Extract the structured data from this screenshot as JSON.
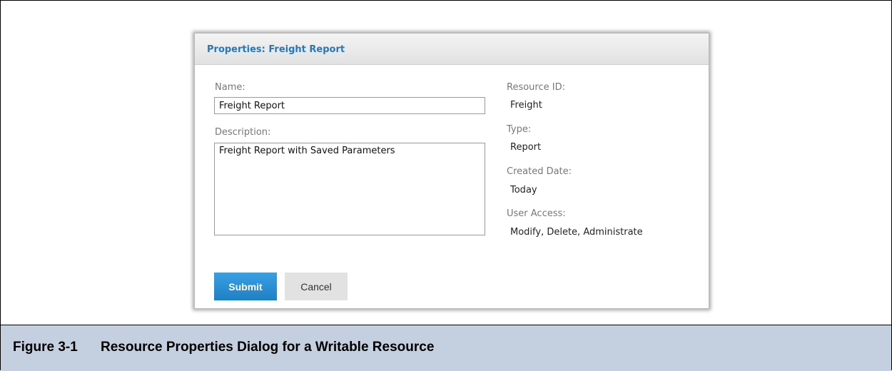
{
  "dialog": {
    "title": "Properties: Freight Report",
    "name_label": "Name:",
    "name_value": "Freight Report",
    "description_label": "Description:",
    "description_value": "Freight Report with Saved Parameters",
    "resource_id_label": "Resource ID:",
    "resource_id_value": "Freight",
    "type_label": "Type:",
    "type_value": "Report",
    "created_label": "Created Date:",
    "created_value": "Today",
    "access_label": "User Access:",
    "access_value": "Modify, Delete, Administrate",
    "submit_label": "Submit",
    "cancel_label": "Cancel"
  },
  "caption": {
    "number": "Figure 3-1",
    "text": "Resource Properties Dialog for a Writable Resource"
  },
  "colors": {
    "title_blue": "#2a77b5",
    "submit_blue": "#2388d0",
    "caption_bg": "#c4cfe0"
  }
}
